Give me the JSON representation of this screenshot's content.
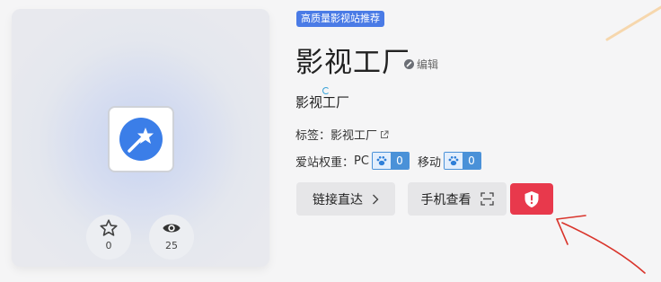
{
  "card": {
    "app_icon": "magic-wand-icon",
    "stats": [
      {
        "icon": "star-icon",
        "value": "0"
      },
      {
        "icon": "eye-icon",
        "value": "25"
      }
    ]
  },
  "badge": "高质量影视站推荐",
  "title": "影视工厂",
  "edit_label": "编辑",
  "subtitle": "影视工厂",
  "tags": {
    "label": "标签：",
    "value": "影视工厂"
  },
  "weight": {
    "label": "爱站权重：",
    "pc_label": "PC",
    "pc_value": "0",
    "mobile_label": "移动",
    "mobile_value": "0"
  },
  "buttons": {
    "direct_link": "链接直达",
    "mobile_view": "手机查看",
    "report_icon": "shield-alert-icon"
  },
  "colors": {
    "badge": "#4a7be6",
    "report": "#e8394c",
    "pill": "#4a91d8",
    "icon_blue": "#3b7ee8",
    "annotation": "#d9342b"
  }
}
